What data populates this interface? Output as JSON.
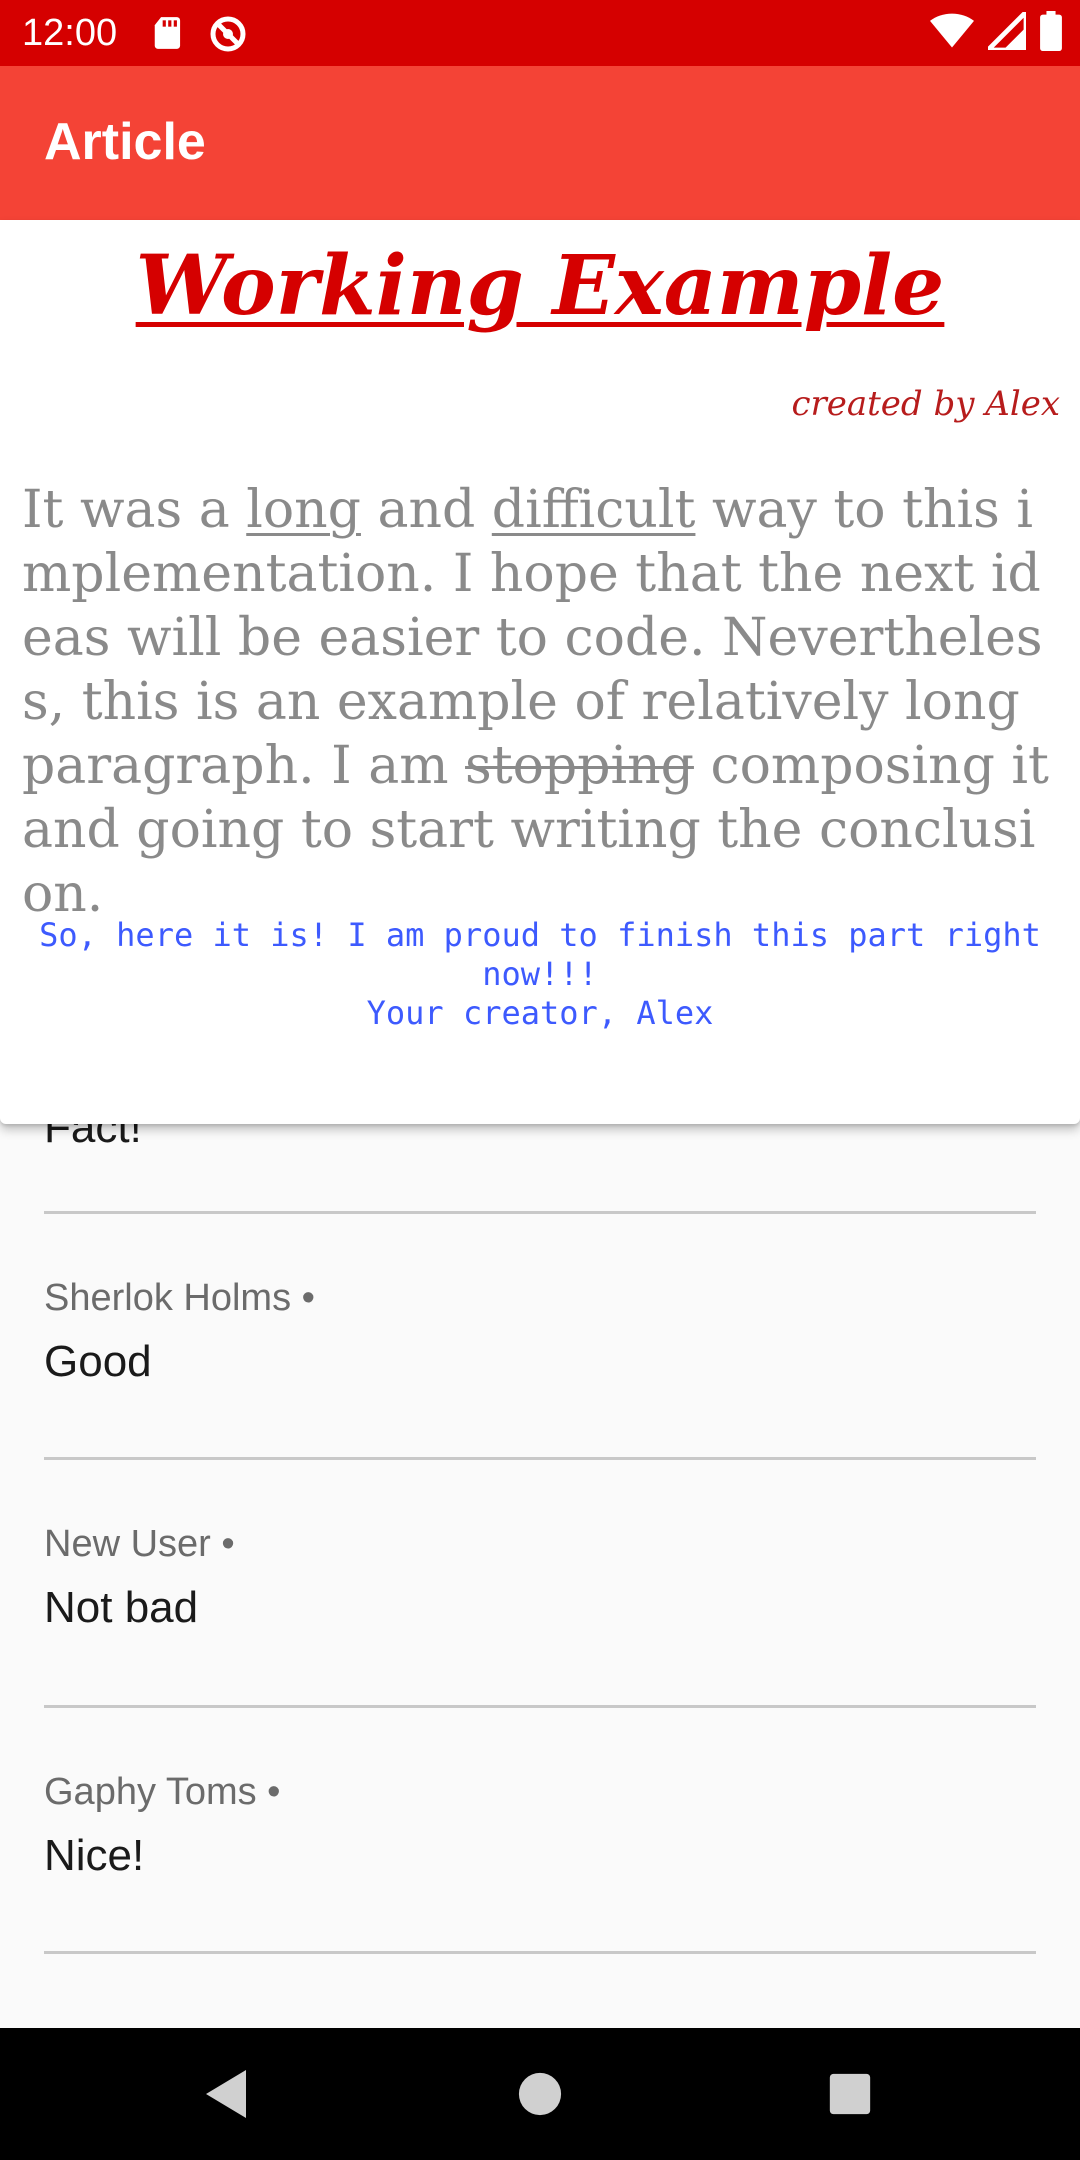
{
  "status_bar": {
    "time": "12:00",
    "left_icons": [
      "sd-card-icon",
      "do-not-disturb-icon"
    ],
    "right_icons": [
      "wifi-icon",
      "cellular-signal-icon",
      "battery-icon"
    ]
  },
  "app_bar": {
    "title": "Article"
  },
  "article": {
    "title": "Working Example",
    "author": "created by Alex",
    "body": {
      "seg1": "It was a ",
      "long": "long",
      "seg2": " and ",
      "difficult": "difficult",
      "seg3": " way to this implementation. I hope that the next ideas will be easier to code. Nevertheless, this is an example of relatively long paragraph. I am ",
      "stopping": "stopping",
      "seg4": " composing it and going to start writing the conclusion."
    },
    "conclusion": {
      "line1": "So, here it is! I am proud to finish this part right now!!!",
      "line2": "Your creator, Alex"
    }
  },
  "comments": [
    {
      "author": "",
      "text": "Fact!"
    },
    {
      "author": "Sherlok Holms",
      "text": "Good"
    },
    {
      "author": "New User",
      "text": "Not bad"
    },
    {
      "author": "Gaphy Toms",
      "text": "Nice!"
    }
  ],
  "colors": {
    "status_bar": "#d50000",
    "app_bar": "#f44336",
    "title": "#d50000",
    "body_text": "#8a8a8a",
    "conclusion_text": "#3d5afe"
  },
  "nav_bar": {
    "buttons": [
      "back-icon",
      "home-icon",
      "recents-icon"
    ]
  }
}
